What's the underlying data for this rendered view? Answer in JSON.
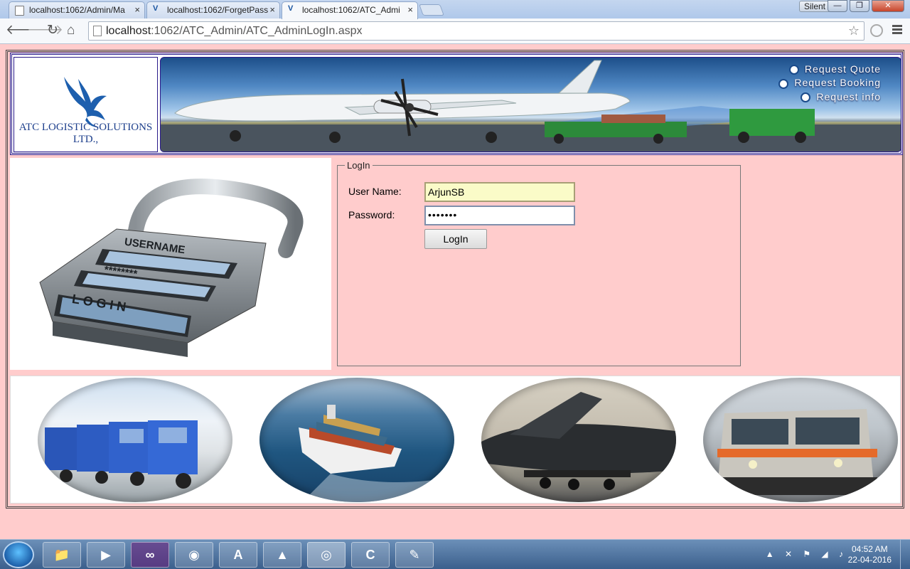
{
  "browser": {
    "tabs": [
      {
        "label": "localhost:1062/Admin/Ma",
        "active": false
      },
      {
        "label": "localhost:1062/ForgetPass",
        "active": false
      },
      {
        "label": "localhost:1062/ATC_Admi",
        "active": true
      }
    ],
    "silent_label": "Silent",
    "url_host": "localhost",
    "url_path": ":1062/ATC_Admin/ATC_AdminLogIn.aspx"
  },
  "header": {
    "company_name": "ATC LOGISTIC SOLUTIONS LTD.,",
    "banner_links": [
      "Request Quote",
      "Request Booking",
      "Request info"
    ]
  },
  "login": {
    "legend": "LogIn",
    "username_label": "User Name:",
    "username_value": "ArjunSB",
    "password_label": "Password:",
    "password_value": "•••••••",
    "login_button": "LogIn"
  },
  "lock_image": {
    "username_text": "USERNAME",
    "password_text": "********",
    "login_text": "L O G I N"
  },
  "taskbar": {
    "time": "04:52 AM",
    "date": "22-04-2016"
  }
}
